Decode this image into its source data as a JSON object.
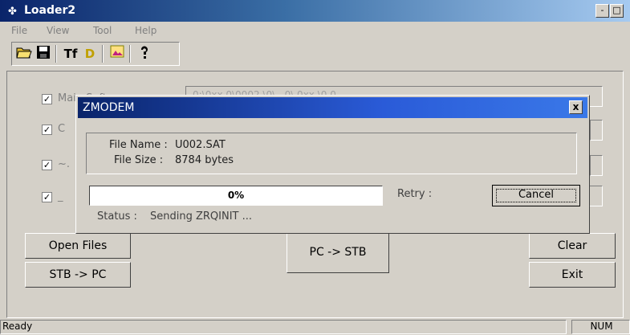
{
  "window": {
    "title": "Loader2",
    "minimize": "-",
    "maximize": "□"
  },
  "menu": [
    "File",
    "View",
    "Tool",
    "Help"
  ],
  "toolbar": {
    "open_icon": "folder-open-icon",
    "save_icon": "save-disk-icon",
    "font_label": "Tf",
    "play_label": "D",
    "image_icon": "image-icon",
    "help_icon": "help-icon"
  },
  "main": {
    "checkboxes": [
      {
        "label": "Main Software",
        "checked": true
      },
      {
        "label": "C",
        "checked": true
      },
      {
        "label": "~.",
        "checked": true
      },
      {
        "label": "_",
        "checked": true
      }
    ],
    "field_top_text": "0:\\0xx.0\\0002 \\0\\  .  0\\ 0xx  \\0.0",
    "buttons": {
      "open_files": "Open Files",
      "stb_to_pc": "STB -> PC",
      "pc_to_stb": "PC -> STB",
      "clear": "Clear",
      "exit": "Exit"
    }
  },
  "statusbar": {
    "left": "Ready",
    "right": "NUM"
  },
  "dialog": {
    "title": "ZMODEM",
    "close": "x",
    "file_name_label": "File Name :",
    "file_name_value": "U002.SAT",
    "file_size_label": "File Size :",
    "file_size_value": "8784 bytes",
    "progress_percent": 0,
    "progress_text": "0%",
    "retry_label": "Retry :",
    "cancel_label": "Cancel",
    "status_label": "Status :",
    "status_value": "Sending ZRQINIT ..."
  },
  "colors": {
    "title_blue": "#0a246a",
    "face": "#d4d0c8"
  }
}
